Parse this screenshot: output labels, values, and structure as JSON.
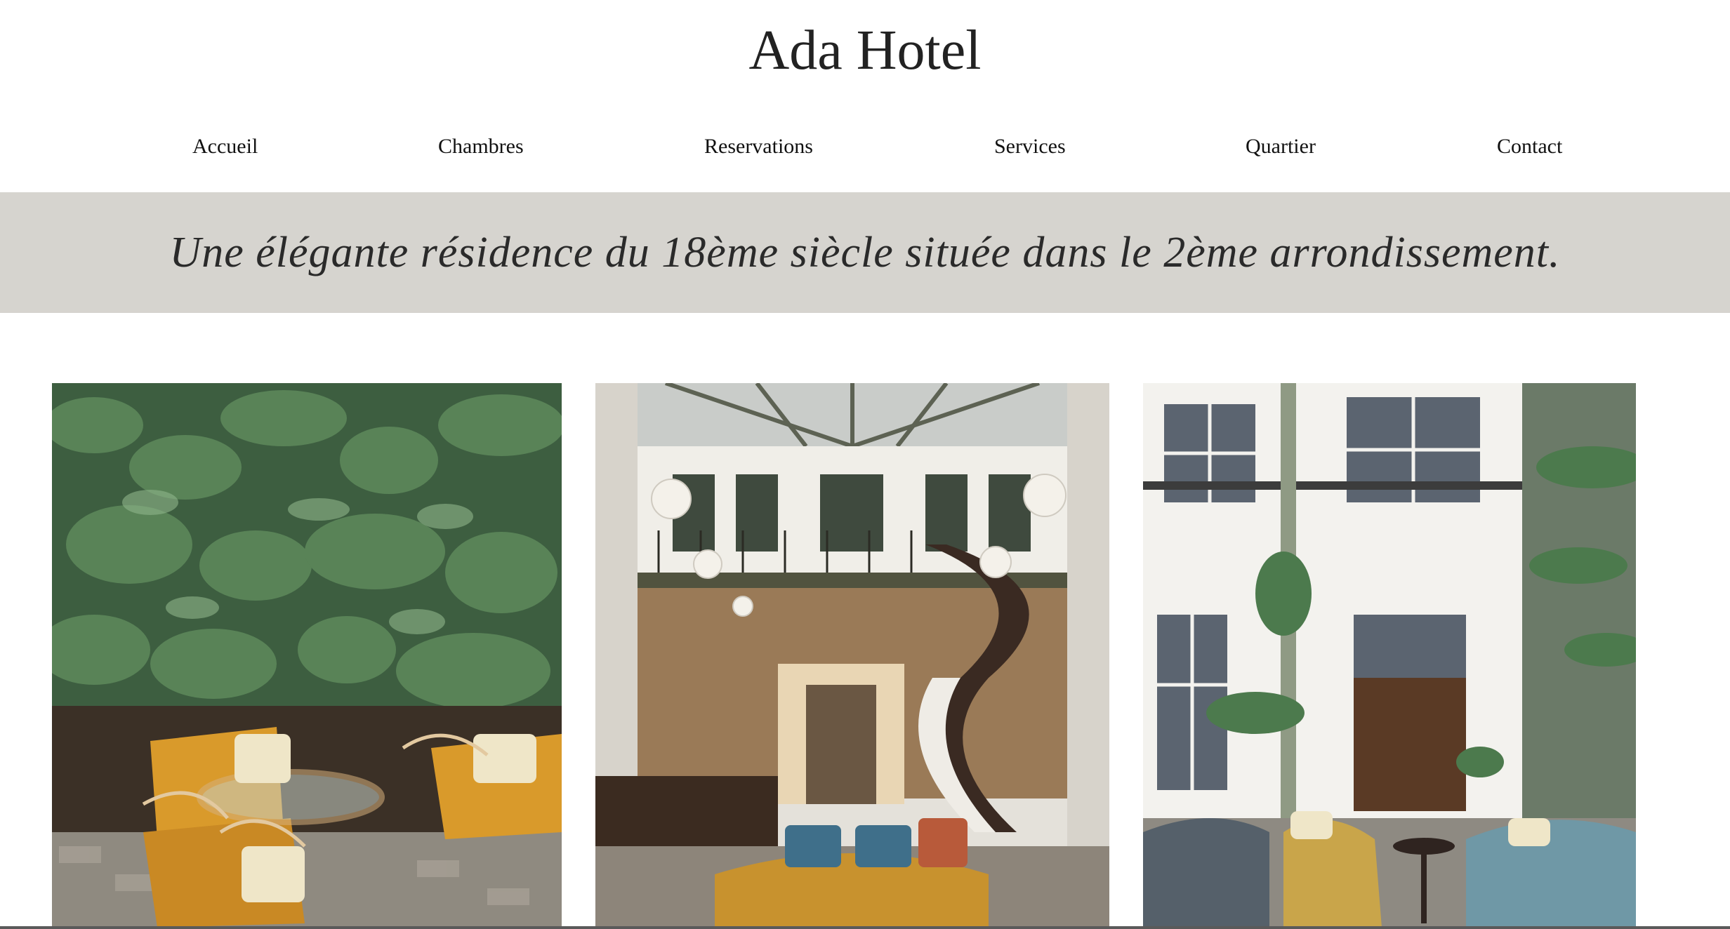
{
  "header": {
    "title": "Ada Hotel"
  },
  "nav": {
    "items": [
      {
        "label": "Accueil"
      },
      {
        "label": "Chambres"
      },
      {
        "label": "Reservations"
      },
      {
        "label": "Services"
      },
      {
        "label": "Quartier"
      },
      {
        "label": "Contact"
      }
    ]
  },
  "hero": {
    "tagline": "Une élégante résidence du 18ème siècle située dans le 2ème arrondissement."
  },
  "colors": {
    "band": "#d6d4cf",
    "text": "#222222"
  }
}
